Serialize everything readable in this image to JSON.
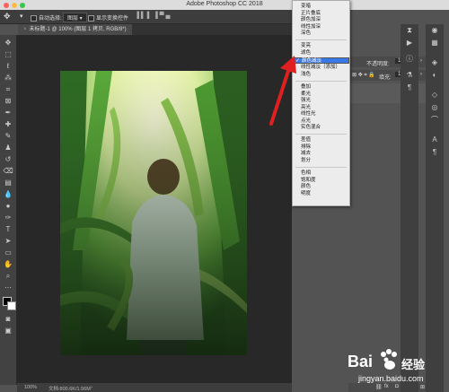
{
  "app": {
    "title": "Adobe Photoshop CC 2018"
  },
  "options_bar": {
    "auto_select_label": "自动选择:",
    "auto_select_value": "图层",
    "show_transform_label": "显示变换控件"
  },
  "document_tab": {
    "label": "未标题-1 @ 100% (图层 1 拷贝, RGB/8*)"
  },
  "status_bar": {
    "zoom": "100%",
    "doc_info": "文档:800.6K/1.56M"
  },
  "layers_panel": {
    "opacity_label": "不透明度:",
    "opacity_value": "100%",
    "fill_label": "填充:",
    "fill_value": "100%"
  },
  "blend_mode_menu": {
    "groups": [
      [
        "变暗",
        "正片叠底",
        "颜色加深",
        "线性加深",
        "深色"
      ],
      [
        "变亮",
        "滤色",
        "颜色减淡",
        "线性减淡（添加）",
        "浅色"
      ],
      [
        "叠加",
        "柔光",
        "强光",
        "亮光",
        "线性光",
        "点光",
        "实色混合"
      ],
      [
        "差值",
        "排除",
        "减去",
        "划分"
      ],
      [
        "色相",
        "饱和度",
        "颜色",
        "明度"
      ]
    ],
    "selected": "颜色减淡",
    "check_mark": "✓"
  },
  "watermark": {
    "brand": "Bai",
    "brand2": "经验",
    "url": "jingyan.baidu.com"
  },
  "colors": {
    "menu_highlight": "#3b78e7",
    "arrow": "#e02020"
  },
  "icons": {
    "toolbar": [
      "move-icon",
      "marquee-icon",
      "lasso-icon",
      "quick-select-icon",
      "crop-icon",
      "eyedropper-icon",
      "healing-icon",
      "brush-icon",
      "stamp-icon",
      "history-brush-icon",
      "eraser-icon",
      "gradient-icon",
      "blur-icon",
      "dodge-icon",
      "pen-icon",
      "text-icon",
      "path-select-icon",
      "shape-icon",
      "hand-icon",
      "zoom-icon"
    ]
  }
}
